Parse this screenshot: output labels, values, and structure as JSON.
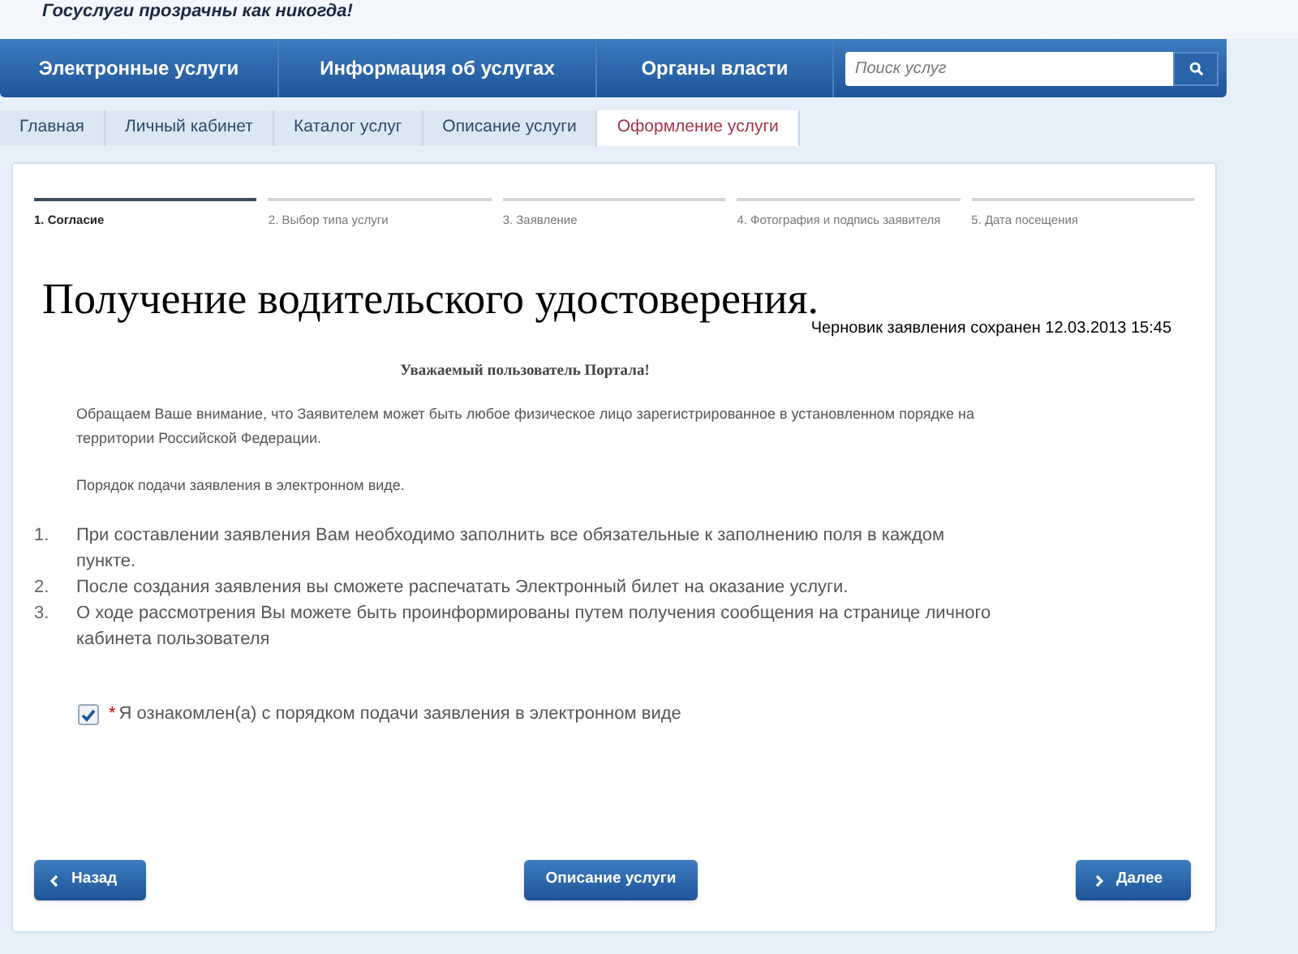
{
  "header": {
    "slogan": "Госуслуги прозрачны как никогда!"
  },
  "nav": {
    "items": [
      "Электронные услуги",
      "Информация об услугах",
      "Органы власти"
    ],
    "search": {
      "placeholder": "Поиск услуг"
    }
  },
  "breadcrumbs": [
    {
      "label": "Главная",
      "selected": false
    },
    {
      "label": "Личный кабинет",
      "selected": false
    },
    {
      "label": "Каталог услуг",
      "selected": false
    },
    {
      "label": "Описание услуги",
      "selected": false
    },
    {
      "label": "Оформление услуги",
      "selected": true
    }
  ],
  "steps": [
    {
      "label": "1. Согласие",
      "selected": true
    },
    {
      "label": "2. Выбор типа услуги",
      "selected": false
    },
    {
      "label": "3. Заявление",
      "selected": false
    },
    {
      "label": "4. Фотография и подпись заявителя",
      "selected": false
    },
    {
      "label": "5. Дата посещения",
      "selected": false
    }
  ],
  "title": "Получение водительского удостоверения.",
  "draft_note": "Черновик заявления сохранен 12.03.2013 15:45",
  "greeting": "Уважаемый пользователь Портала!",
  "paragraphs": [
    "Обращаем Ваше внимание, что Заявителем может быть любое физическое лицо зарегистрированное в установленном порядке на территории Российской Федерации.",
    "Порядок подачи заявления в электронном виде."
  ],
  "steps_list": [
    {
      "number": "1.",
      "text": "При составлении заявления Вам необходимо заполнить все обязательные к заполнению поля в каждом пункте."
    },
    {
      "number": "2.",
      "text": "После создания заявления вы сможете распечатать Электронный билет на оказание услуги."
    },
    {
      "number": "3.",
      "text": "О ходе рассмотрения Вы можете быть проинформированы путем получения сообщения на странице личного кабинета пользователя"
    }
  ],
  "agreement": {
    "required_mark": "*",
    "label": "Я ознакомлен(а) с порядком подачи заявления в электронном виде",
    "checked": true
  },
  "buttons": {
    "back": "Назад",
    "description": "Описание услуги",
    "next": "Далее"
  }
}
